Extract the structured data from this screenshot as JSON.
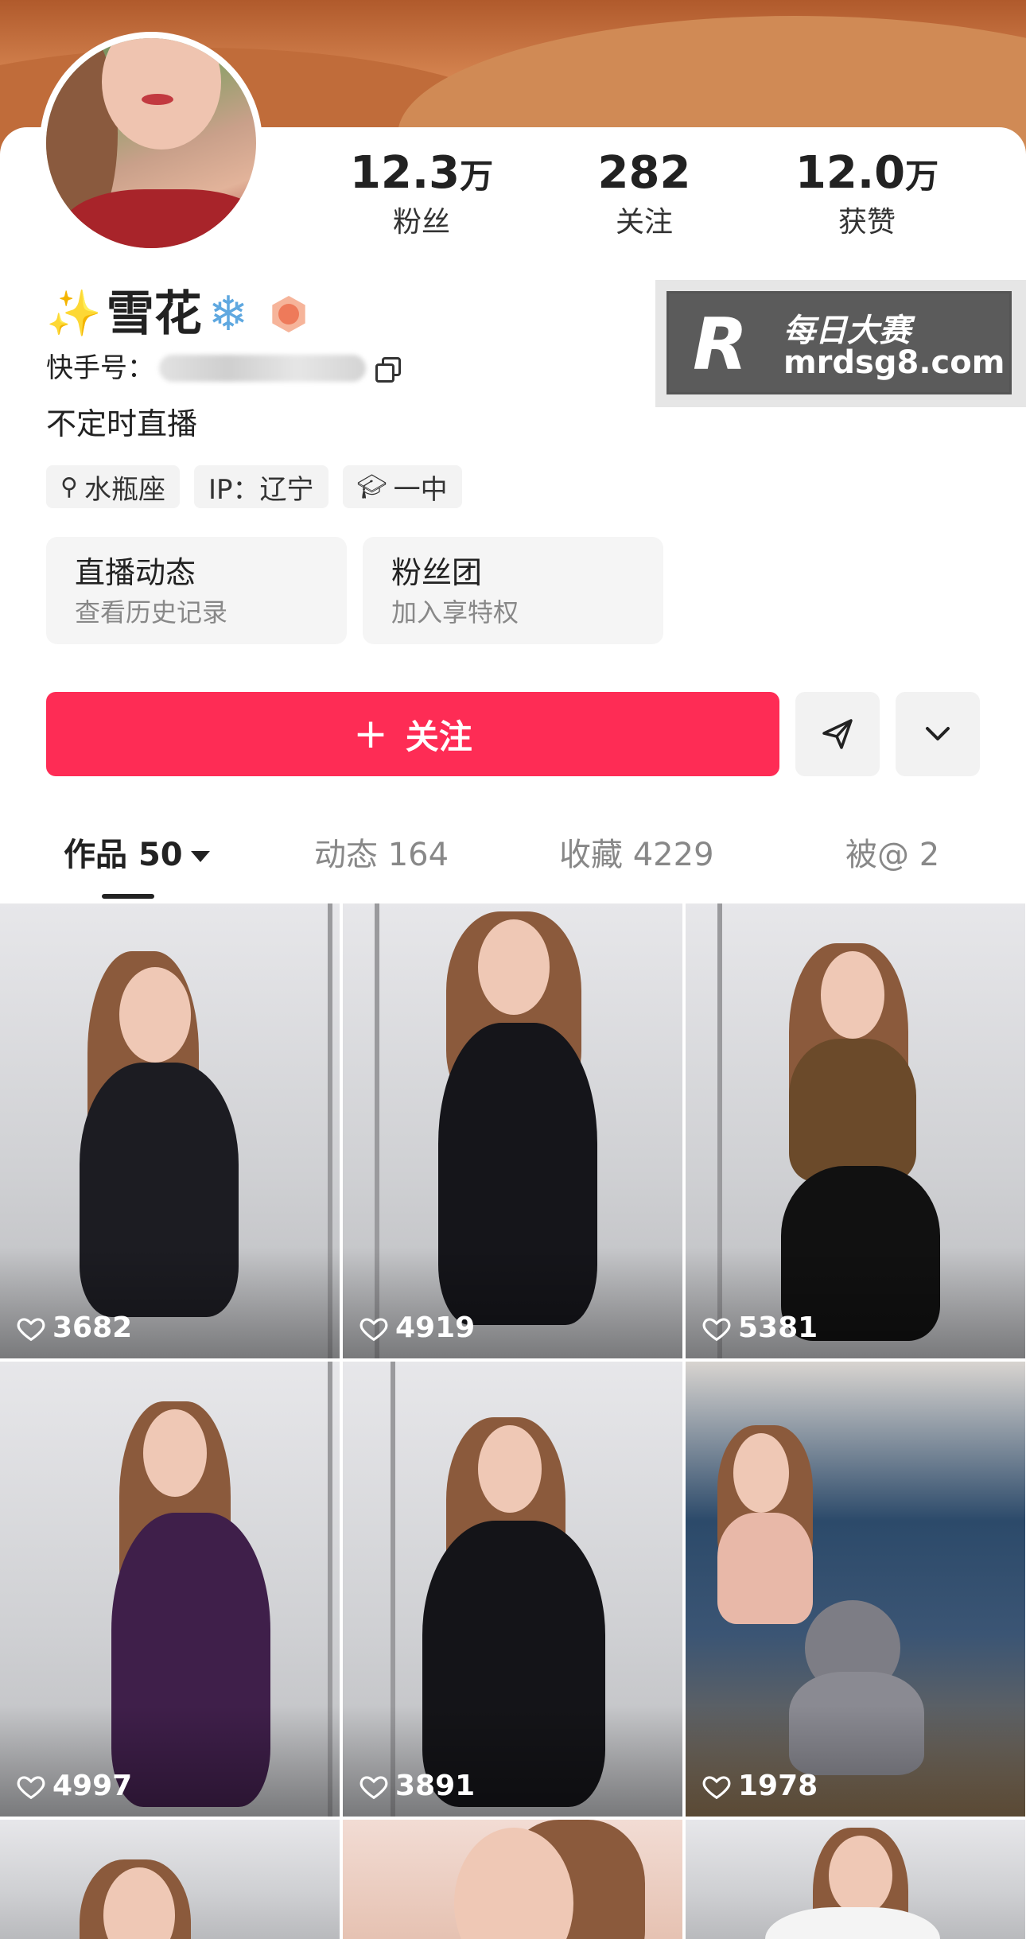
{
  "profile": {
    "nickname": "雪花",
    "kuaishou_id_label": "快手号：",
    "bio": "不定时直播"
  },
  "stats": [
    {
      "value": "12.3",
      "unit": "万",
      "label": "粉丝"
    },
    {
      "value": "282",
      "unit": "",
      "label": "关注"
    },
    {
      "value": "12.0",
      "unit": "万",
      "label": "获赞"
    }
  ],
  "tags": [
    {
      "icon": "search-icon",
      "label": "水瓶座"
    },
    {
      "icon": "",
      "label": "IP：辽宁"
    },
    {
      "icon": "graduation-cap-icon",
      "label": "一中"
    }
  ],
  "cards": [
    {
      "title": "直播动态",
      "subtitle": "查看历史记录"
    },
    {
      "title": "粉丝团",
      "subtitle": "加入享特权"
    }
  ],
  "actions": {
    "follow_label": "关注"
  },
  "watermark": {
    "cn_text": "每日大赛",
    "url": "mrdsg8.com"
  },
  "tabs": [
    {
      "label": "作品",
      "count": "50",
      "active": true
    },
    {
      "label": "动态",
      "count": "164",
      "active": false
    },
    {
      "label": "收藏",
      "count": "4229",
      "active": false
    },
    {
      "label": "被@",
      "count": "2",
      "active": false
    }
  ],
  "videos": [
    {
      "likes": "3682"
    },
    {
      "likes": "4919"
    },
    {
      "likes": "5381"
    },
    {
      "likes": "4997"
    },
    {
      "likes": "3891"
    },
    {
      "likes": "1978"
    },
    {
      "likes": ""
    },
    {
      "likes": ""
    },
    {
      "likes": ""
    }
  ],
  "colors": {
    "accent": "#fe2c55",
    "text": "#222222",
    "muted": "#888888"
  }
}
